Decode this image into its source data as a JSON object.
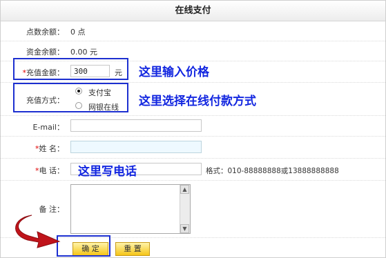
{
  "title": "在线支付",
  "rows": {
    "points_label": "点数余额：",
    "points_value": "0 点",
    "funds_label": "资金余额：",
    "funds_value": "0.00 元",
    "recharge_label": "充值金额：",
    "recharge_value": "300",
    "recharge_unit": "元",
    "method_label": "充值方式：",
    "method_options": [
      "支付宝",
      "网银在线"
    ],
    "email_label": "E-mail：",
    "name_label": "姓  名：",
    "phone_label": "电  话：",
    "phone_format": "格式：010-88888888或13888888888",
    "remark_label": "备  注："
  },
  "annotations": {
    "amount": "这里输入价格",
    "method": "这里选择在线付款方式",
    "phone": "这里写电话"
  },
  "buttons": {
    "confirm": "确 定",
    "reset": "重 置"
  },
  "required_marker": "*",
  "colors": {
    "callout": "#1c2fd0",
    "annotation_text": "#1226e0",
    "required": "#e00000",
    "button": "#f5c518",
    "arrow": "#c0141b"
  }
}
